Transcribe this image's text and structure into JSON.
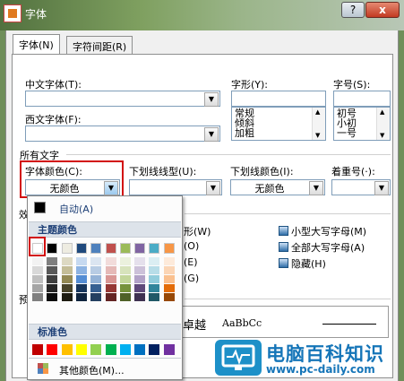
{
  "window": {
    "title": "字体",
    "help": "?",
    "close": "x"
  },
  "tabs": [
    {
      "label": "字体(N)"
    },
    {
      "label": "字符间距(R)"
    }
  ],
  "font": {
    "chinese_font_label": "中文字体(T):",
    "chinese_font_value": "",
    "western_font_label": "西文字体(F):",
    "western_font_value": "",
    "style_label": "字形(Y):",
    "style_value": "",
    "style_options": [
      "常规",
      "倾斜",
      "加粗"
    ],
    "size_label": "字号(S):",
    "size_value": "",
    "size_options": [
      "初号",
      "小初",
      "一号"
    ]
  },
  "all_text": {
    "section_label": "所有文字",
    "color_label": "字体颜色(C):",
    "color_value": "无颜色",
    "underline_label": "下划线线型(U):",
    "underline_value": "",
    "underline_color_label": "下划线颜色(I):",
    "underline_color_value": "无颜色",
    "emphasis_label": "着重号(·):",
    "emphasis_value": ""
  },
  "effects": {
    "section_label_fragment": "效",
    "left_fragments": [
      "形(W)",
      "(O)",
      "(E)",
      "(G)"
    ],
    "small_caps": "小型大写字母(M)",
    "all_caps": "全部大写字母(A)",
    "hidden": "隐藏(H)"
  },
  "preview": {
    "section_fragment": "预",
    "sample_cn": "卓越",
    "sample_en": "AaBbCc"
  },
  "color_menu": {
    "auto_label": "自动(A)",
    "theme_header": "主题颜色",
    "standard_header": "标准色",
    "more_colors": "其他颜色(M)...",
    "theme_colors": [
      "#ffffff",
      "#000000",
      "#eeece1",
      "#1f497d",
      "#4f81bd",
      "#c0504d",
      "#9bbb59",
      "#8064a2",
      "#4bacc6",
      "#f79646"
    ],
    "theme_shades": [
      [
        "#f2f2f2",
        "#d8d8d8",
        "#bfbfbf",
        "#a5a5a5",
        "#7f7f7f"
      ],
      [
        "#7f7f7f",
        "#595959",
        "#3f3f3f",
        "#262626",
        "#0c0c0c"
      ],
      [
        "#ddd9c3",
        "#c4bd97",
        "#938953",
        "#494429",
        "#1d1b10"
      ],
      [
        "#c6d9f0",
        "#8db3e2",
        "#548dd4",
        "#17365d",
        "#0f243e"
      ],
      [
        "#dbe5f1",
        "#b8cce4",
        "#95b3d7",
        "#366092",
        "#244061"
      ],
      [
        "#f2dcdb",
        "#e5b9b7",
        "#d99694",
        "#953734",
        "#632423"
      ],
      [
        "#ebf1dd",
        "#d7e3bc",
        "#c3d69b",
        "#76923c",
        "#4f6128"
      ],
      [
        "#e5e0ec",
        "#ccc1d9",
        "#b2a2c7",
        "#5f497a",
        "#3f3151"
      ],
      [
        "#dbeef3",
        "#b7dde8",
        "#92cddc",
        "#31859b",
        "#205867"
      ],
      [
        "#fdeada",
        "#fbd5b5",
        "#fac08f",
        "#e36c09",
        "#974806"
      ]
    ],
    "standard_colors": [
      "#c00000",
      "#ff0000",
      "#ffc000",
      "#ffff00",
      "#92d050",
      "#00b050",
      "#00b0f0",
      "#0070c0",
      "#002060",
      "#7030a0"
    ]
  },
  "watermark": {
    "title": "电脑百科知识",
    "url": "www.pc-daily.com"
  }
}
